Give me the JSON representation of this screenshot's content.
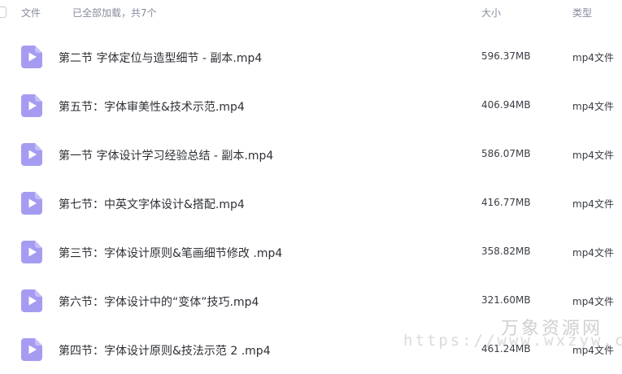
{
  "header": {
    "col_name": "文件",
    "status": "已全部加载，共7个",
    "col_size": "大小",
    "col_type": "类型"
  },
  "files": [
    {
      "name": "第二节 字体定位与造型细节 - 副本.mp4",
      "size": "596.37MB",
      "type": "mp4文件",
      "icon": "video-file-icon"
    },
    {
      "name": "第五节：字体审美性&技术示范.mp4",
      "size": "406.94MB",
      "type": "mp4文件",
      "icon": "video-file-icon"
    },
    {
      "name": "第一节 字体设计学习经验总结 - 副本.mp4",
      "size": "586.07MB",
      "type": "mp4文件",
      "icon": "video-file-icon"
    },
    {
      "name": "第七节：中英文字体设计&搭配.mp4",
      "size": "416.77MB",
      "type": "mp4文件",
      "icon": "video-file-icon"
    },
    {
      "name": "第三节：字体设计原则&笔画细节修改 .mp4",
      "size": "358.82MB",
      "type": "mp4文件",
      "icon": "video-file-icon"
    },
    {
      "name": "第六节：字体设计中的“变体”技巧.mp4",
      "size": "321.60MB",
      "type": "mp4文件",
      "icon": "video-file-icon"
    },
    {
      "name": "第四节：字体设计原则&技法示范 2 .mp4",
      "size": "461.24MB",
      "type": "mp4文件",
      "icon": "video-file-icon"
    }
  ],
  "watermark": {
    "text_cn": "万象资源网",
    "text_url": "https://www.wxzyw.cn"
  },
  "colors": {
    "icon_fill": "#a59cf2",
    "icon_play": "#ffffff",
    "header_text": "#878c9c",
    "row_text": "#2e3035"
  }
}
